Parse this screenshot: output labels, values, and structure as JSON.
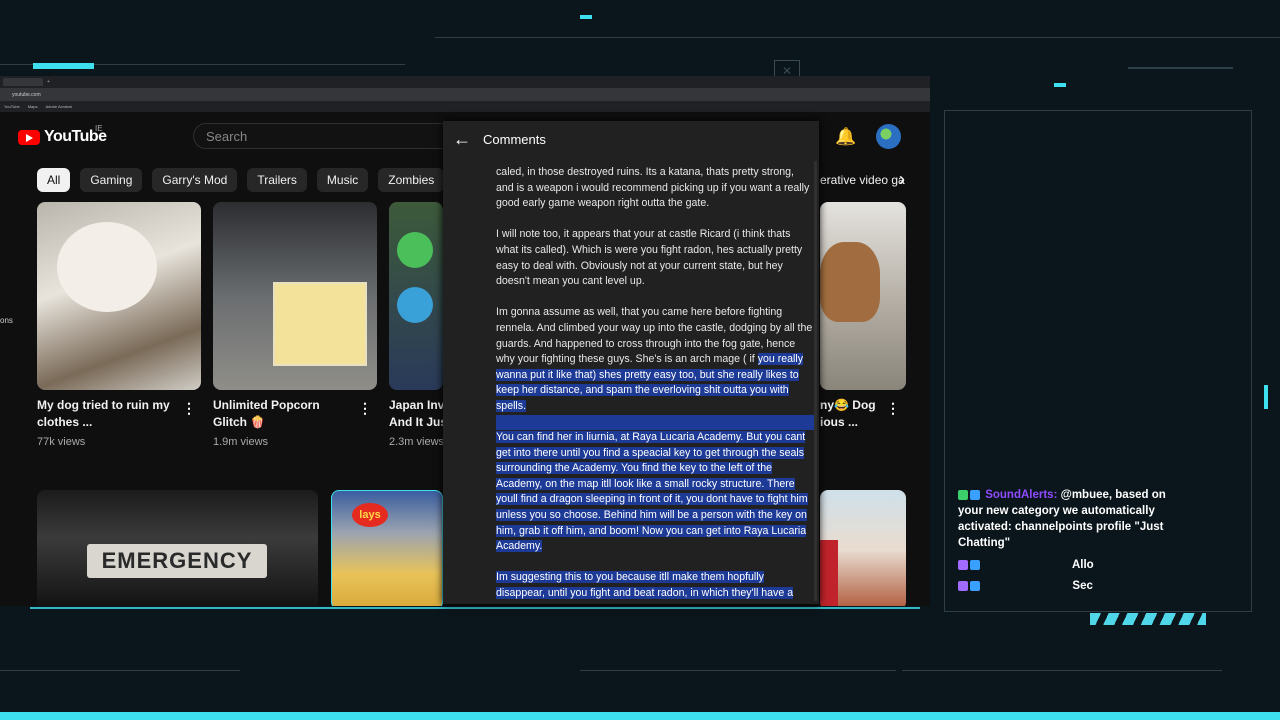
{
  "browser": {
    "url": "youtube.com",
    "bookmarks": [
      "YouTube",
      "Maps",
      "Adobe Acrobat"
    ]
  },
  "youtube": {
    "logo_text": "YouTube",
    "region": "IE",
    "search_placeholder": "Search",
    "chips": [
      "All",
      "Gaming",
      "Garry's Mod",
      "Trailers",
      "Music",
      "Zombies",
      "M"
    ],
    "chip_right": "erative video ga",
    "videos_row1": [
      {
        "title_lines": [
          "My dog tried to ruin my",
          "clothes ..."
        ],
        "views": "77k views"
      },
      {
        "title_lines": [
          "Unlimited Popcorn",
          "Glitch 🍿"
        ],
        "views": "1.9m views"
      },
      {
        "title_lines": [
          "Japan Inv",
          "And It Jus"
        ],
        "views": "2.3m views"
      },
      {
        "title_lines": [
          "ny😂 Dog",
          "ious ..."
        ],
        "views": ""
      }
    ],
    "thumb_text": {
      "emergency": "EMERGENCY",
      "lays": "lays"
    },
    "left_edge_text": "ons"
  },
  "comments": {
    "title": "Comments",
    "paragraphs": [
      {
        "text": "caled, in those destroyed ruins. Its a katana, thats pretty strong, and is a weapon i would recommend picking up if you want a really good early game weapon right outta the gate.",
        "highlight": false
      },
      {
        "text": "I will note too, it appears that your at castle Ricard (i think thats what its called). Which is were you fight radon, hes actually pretty easy to deal with. Obviously not at your current state, but hey doesn't mean you cant level up.",
        "highlight": false
      },
      {
        "text": " Im gonna assume as well, that you came here before fighting rennela. And climbed your way up into the castle, dodging by all the guards. And happened to cross through into the fog gate, hence why your fighting these guys. She's is an arch mage ( if",
        "highlight": false
      },
      {
        "text": "you really wanna put it like that) shes pretty easy too, but she really likes to keep her distance, and spam the everloving shit outta you with spells.",
        "highlight": true
      },
      {
        "text": "You can find her in liurnia, at Raya Lucaria Academy. But you cant get into there until you find a speacial key to get through the seals surrounding the Academy. You find the key to the left of the Academy, on the map itll look like a small rocky structure. There youll find a dragon sleeping in front of it, you dont have to fight him unless you so choose. Behind him will be a person with the key on him, grab it off him, and boom! Now you can get into Raya Lucaria Academy.",
        "highlight": true
      },
      {
        "text": "Im suggesting this to you because itll make them hopfully disappear, until you fight and beat radon, in which they'll have a",
        "highlight": true
      }
    ]
  },
  "chat": {
    "messages": [
      {
        "user": "SoundAlerts:",
        "text": "@mbuee, based on your new category we automatically activated: channelpoints profile \"Just Chatting\""
      },
      {
        "user": "",
        "text": "Allo"
      },
      {
        "user": "",
        "text": "Sec"
      }
    ]
  },
  "colors": {
    "accent": "#3ee0f0",
    "highlight": "#1d3b96",
    "yt_red": "#ff0000",
    "panel": "#212121"
  }
}
